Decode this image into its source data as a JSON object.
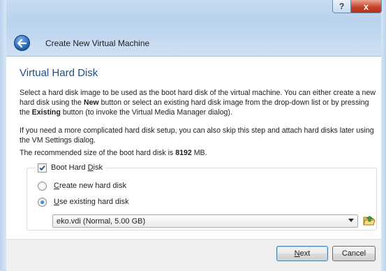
{
  "window": {
    "title": "Create New Virtual Machine",
    "help_glyph": "?",
    "close_glyph": "x"
  },
  "page": {
    "title": "Virtual Hard Disk",
    "p1_a": "Select a hard disk image to be used as the boot hard disk of the virtual machine. You can either create a new hard disk using the ",
    "p1_new": "New",
    "p1_b": " button or select an existing hard disk image from the drop-down list or by pressing the ",
    "p1_existing": "Existing",
    "p1_c": " button (to invoke the Virtual Media Manager dialog).",
    "p2": "If you need a more complicated hard disk setup, you can also skip this step and attach hard disks later using the VM Settings dialog.",
    "p3_a": "The recommended size of the boot hard disk is ",
    "p3_size": "8192",
    "p3_b": " MB."
  },
  "boot_disk": {
    "checkbox_label_pre": "Boot Hard ",
    "checkbox_label_u": "D",
    "checkbox_label_post": "isk",
    "checked": true,
    "create_u": "C",
    "create_rest": "reate new hard disk",
    "use_u": "U",
    "use_rest": "se existing hard disk",
    "selected_option": "use_existing",
    "combo_value": "eko.vdi (Normal, 5.00 GB)"
  },
  "buttons": {
    "next_u": "N",
    "next_rest": "ext",
    "cancel": "Cancel"
  },
  "colors": {
    "title_blue": "#1a4f8b",
    "close_red": "#c7452a",
    "back_blue": "#1d5fae"
  },
  "icons": {
    "back": "back-arrow-icon",
    "checkmark": "checkmark-icon",
    "dropdown": "chevron-down-icon",
    "folder": "open-folder-icon"
  }
}
